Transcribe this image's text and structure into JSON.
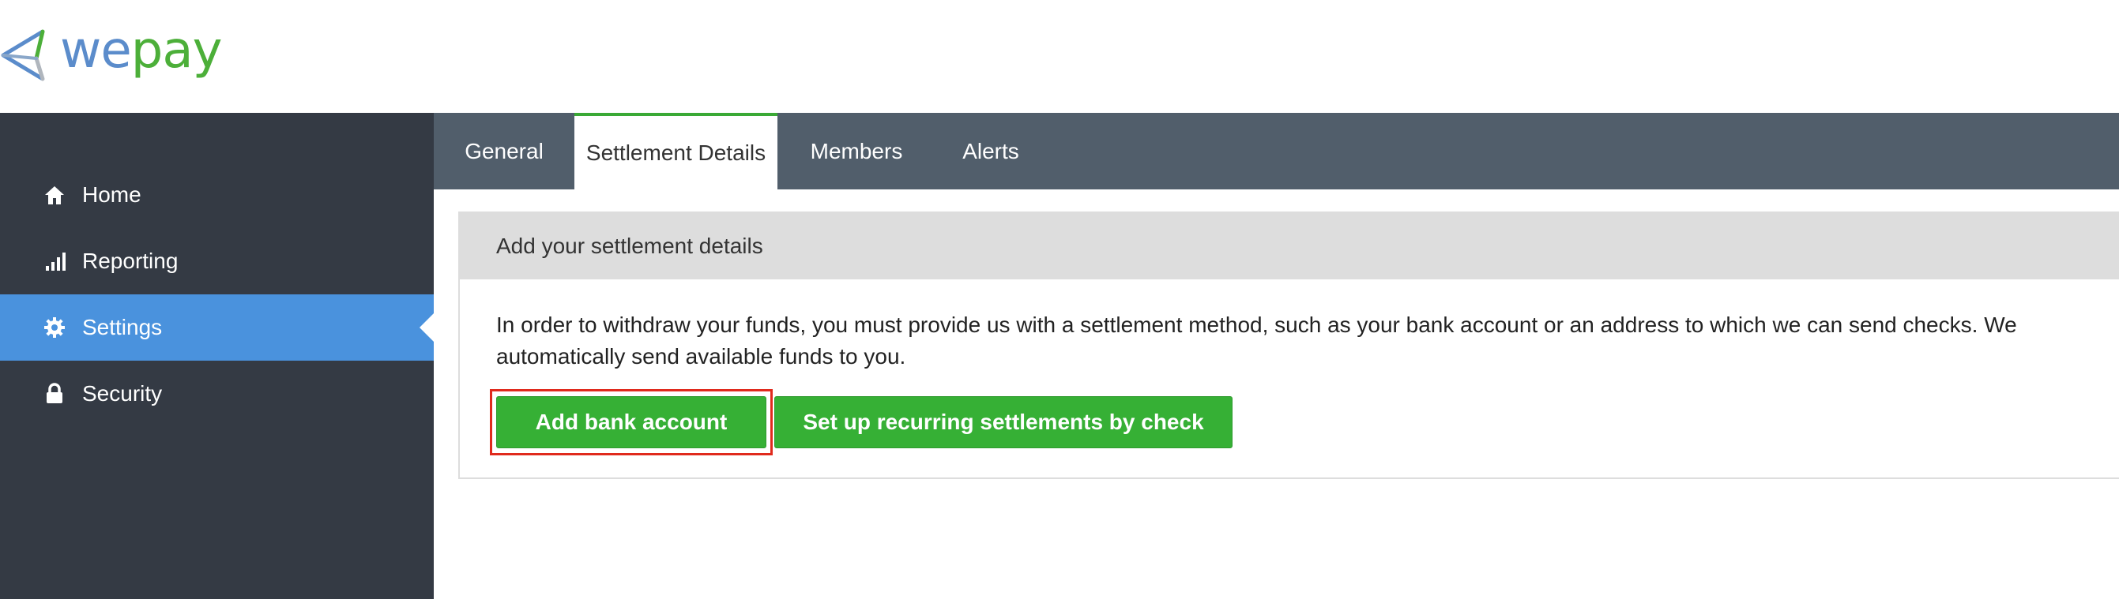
{
  "logo": {
    "we": "we",
    "pay": "pay",
    "icon": "wepay-arrow-logo"
  },
  "sidebar": {
    "items": [
      {
        "label": "Home",
        "icon": "home-icon"
      },
      {
        "label": "Reporting",
        "icon": "signal-bars-icon"
      },
      {
        "label": "Settings",
        "icon": "gear-icon",
        "active": true
      },
      {
        "label": "Security",
        "icon": "lock-icon"
      }
    ]
  },
  "tabs": [
    {
      "label": "General"
    },
    {
      "label": "Settlement Details",
      "active": true
    },
    {
      "label": "Members"
    },
    {
      "label": "Alerts"
    }
  ],
  "panel": {
    "title": "Add your settlement details",
    "description": "In order to withdraw your funds, you must provide us with a settlement method, such as your bank account or an address to which we can send checks. We automatically send available funds to you.",
    "buttons": {
      "bank": "Add bank account",
      "check": "Set up recurring settlements by check"
    }
  },
  "colors": {
    "sidebar_bg": "#343a44",
    "active_nav": "#4a92dd",
    "tabbar_bg": "#515e6b",
    "button_green": "#36b035",
    "highlight_red": "#e02a1d"
  }
}
